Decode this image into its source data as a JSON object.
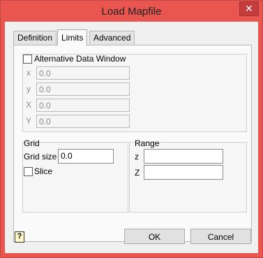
{
  "window": {
    "title": "Load Mapfile",
    "close_glyph": "✕"
  },
  "tabs": [
    {
      "label": "Definition",
      "active": false
    },
    {
      "label": "Limits",
      "active": true
    },
    {
      "label": "Advanced",
      "active": false
    }
  ],
  "alt_window": {
    "checkbox_label": "Alternative Data Window",
    "checked": false,
    "fields": [
      {
        "label": "x",
        "value": "0.0"
      },
      {
        "label": "y",
        "value": "0.0"
      },
      {
        "label": "X",
        "value": "0.0"
      },
      {
        "label": "Y",
        "value": "0.0"
      }
    ]
  },
  "grid": {
    "title": "Grid",
    "size_label": "Grid size",
    "size_value": "0.0",
    "slice_label": "Slice",
    "slice_checked": false
  },
  "range": {
    "title": "Range",
    "z_label": "z",
    "z_value": "",
    "Z_label": "Z",
    "Z_value": ""
  },
  "buttons": {
    "ok": "OK",
    "cancel": "Cancel"
  },
  "help_glyph": "?"
}
